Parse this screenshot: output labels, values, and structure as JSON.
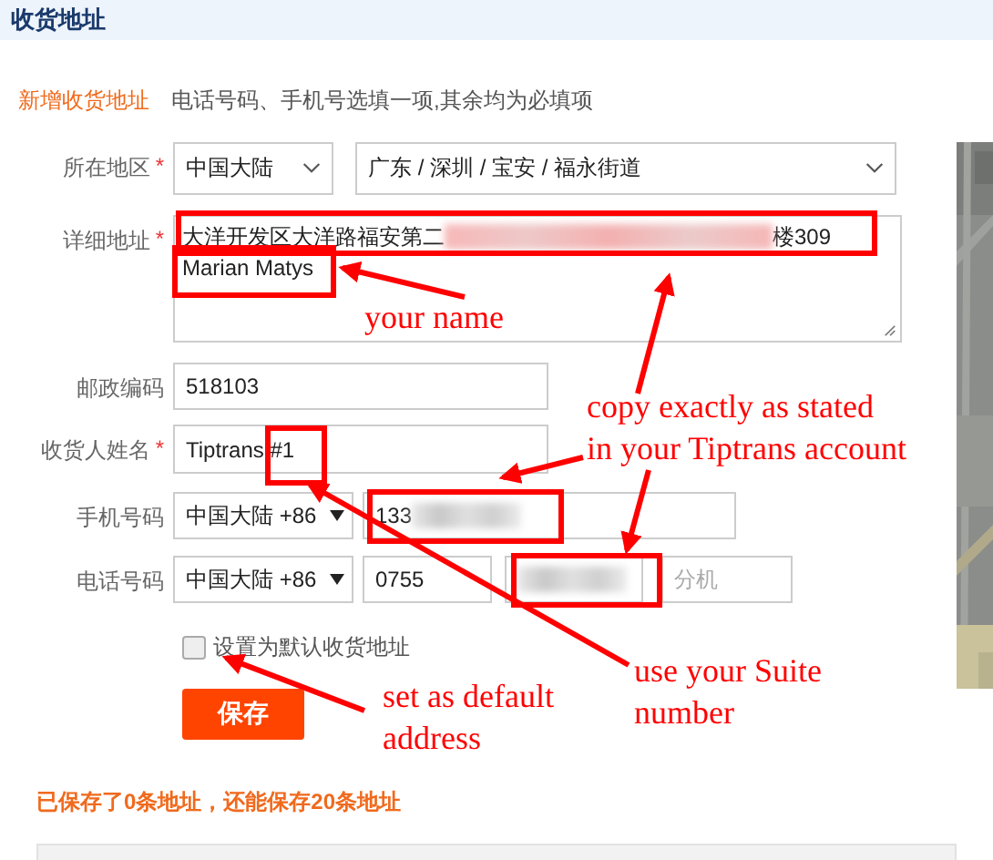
{
  "header": {
    "title": "收货地址"
  },
  "form": {
    "heading": "新增收货地址",
    "hint": "电话号码、手机号选填一项,其余均为必填项",
    "region": {
      "label": "所在地区",
      "required_mark": "*",
      "country": "中国大陆",
      "area": "广东 / 深圳 / 宝安 / 福永街道"
    },
    "address": {
      "label": "详细地址",
      "required_mark": "*",
      "line_start": "大洋开发区大洋路福安第二",
      "line_end": "楼309",
      "second_line": "Marian Matys"
    },
    "zip": {
      "label": "邮政编码",
      "value": "518103"
    },
    "recipient": {
      "label": "收货人姓名",
      "required_mark": "*",
      "value": "Tiptrans #1"
    },
    "mobile": {
      "label": "手机号码",
      "country": "中国大陆 +86",
      "value": "133"
    },
    "phone": {
      "label": "电话号码",
      "country": "中国大陆 +86",
      "area_code": "0755",
      "extension_placeholder": "分机"
    },
    "default": {
      "label": "设置为默认收货地址",
      "checked": false
    },
    "save": "保存",
    "footer": "已保存了0条地址，还能保存20条地址"
  },
  "annotations": [
    {
      "text": "your name",
      "kind": "label"
    },
    {
      "text": "copy exactly as stated\nin your Tiptrans account",
      "kind": "label"
    },
    {
      "text": "use your Suite\nnumber",
      "kind": "label"
    },
    {
      "text": "set as default\naddress",
      "kind": "label"
    }
  ]
}
